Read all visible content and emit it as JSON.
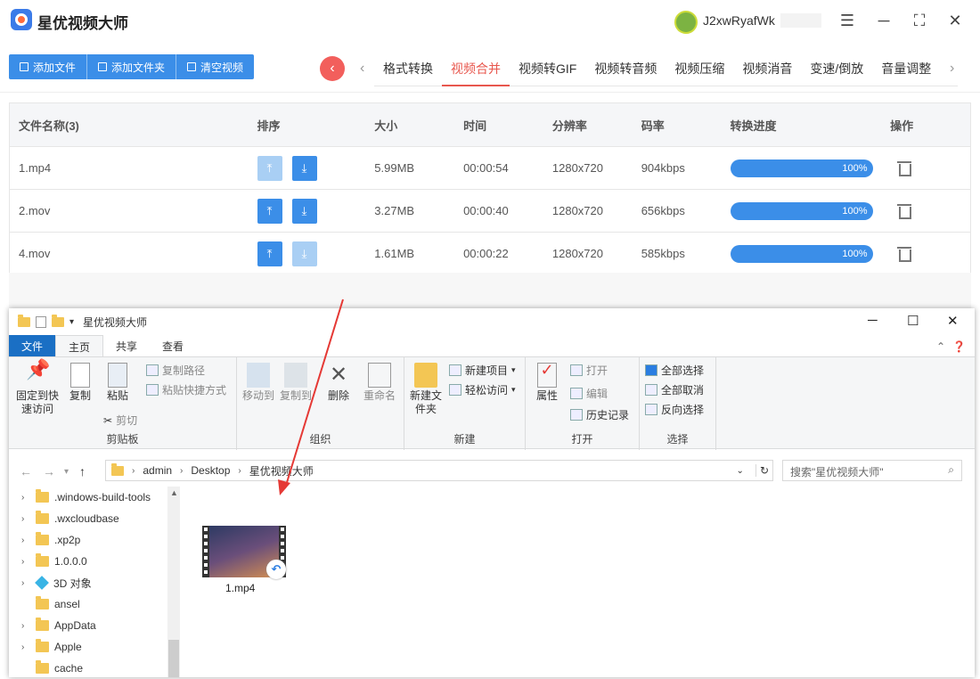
{
  "app": {
    "title": "星优视频大师",
    "username": "J2xwRyafWk"
  },
  "toolbar": {
    "add_file": "添加文件",
    "add_folder": "添加文件夹",
    "clear": "清空视频"
  },
  "tabs": [
    "格式转换",
    "视频合并",
    "视频转GIF",
    "视频转音频",
    "视频压缩",
    "视频消音",
    "变速/倒放",
    "音量调整"
  ],
  "active_tab": "视频合并",
  "table": {
    "headers": [
      "文件名称(3)",
      "排序",
      "大小",
      "时间",
      "分辨率",
      "码率",
      "转换进度",
      "操作"
    ],
    "rows": [
      {
        "name": "1.mp4",
        "size": "5.99MB",
        "time": "00:00:54",
        "res": "1280x720",
        "bitrate": "904kbps",
        "progress": "100%"
      },
      {
        "name": "2.mov",
        "size": "3.27MB",
        "time": "00:00:40",
        "res": "1280x720",
        "bitrate": "656kbps",
        "progress": "100%"
      },
      {
        "name": "4.mov",
        "size": "1.61MB",
        "time": "00:00:22",
        "res": "1280x720",
        "bitrate": "585kbps",
        "progress": "100%"
      }
    ]
  },
  "explorer": {
    "title": "星优视频大师",
    "ribbon_tabs": [
      "文件",
      "主页",
      "共享",
      "查看"
    ],
    "clipboard": {
      "pin": "固定到快速访问",
      "copy": "复制",
      "paste": "粘贴",
      "copy_path": "复制路径",
      "paste_shortcut": "粘贴快捷方式",
      "cut": "剪切",
      "label": "剪贴板"
    },
    "organize": {
      "move_to": "移动到",
      "copy_to": "复制到",
      "delete": "删除",
      "rename": "重命名",
      "label": "组织"
    },
    "new": {
      "new_folder": "新建文件夹",
      "new_item": "新建项目",
      "easy_access": "轻松访问",
      "label": "新建"
    },
    "open": {
      "properties": "属性",
      "open": "打开",
      "edit": "编辑",
      "history": "历史记录",
      "label": "打开"
    },
    "select": {
      "select_all": "全部选择",
      "select_none": "全部取消",
      "invert": "反向选择",
      "label": "选择"
    },
    "path": [
      "admin",
      "Desktop",
      "星优视频大师"
    ],
    "search_placeholder": "搜索\"星优视频大师\"",
    "tree": [
      ".windows-build-tools",
      ".wxcloudbase",
      ".xp2p",
      "1.0.0.0",
      "3D 对象",
      "ansel",
      "AppData",
      "Apple",
      "cache"
    ],
    "file": "1.mp4"
  },
  "colors": {
    "primary": "#3b8ee8",
    "accent": "#e8574e",
    "arrow": "#e53935"
  }
}
